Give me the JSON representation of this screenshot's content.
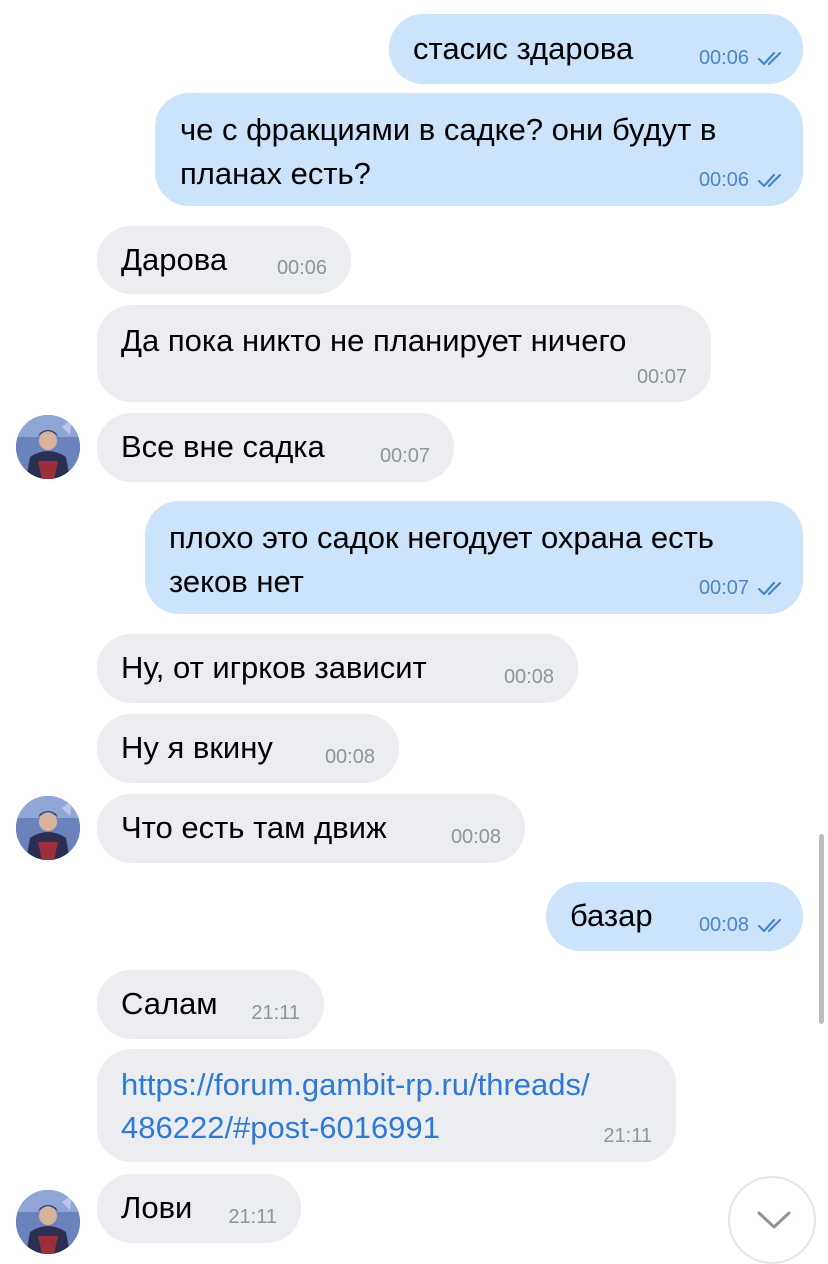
{
  "chat": {
    "messages": [
      {
        "direction": "outgoing",
        "text": "стасис здарова",
        "time": "00:06",
        "read": true
      },
      {
        "direction": "outgoing",
        "lines": [
          "че с фракциями в садке? они будут в",
          "планах есть?"
        ],
        "time": "00:06",
        "read": true
      },
      {
        "direction": "incoming",
        "text": "Дарова",
        "time": "00:06"
      },
      {
        "direction": "incoming",
        "text": "Да пока никто не планирует ничего",
        "time": "00:07"
      },
      {
        "direction": "incoming",
        "text": "Все вне садка",
        "time": "00:07"
      },
      {
        "direction": "outgoing",
        "lines": [
          "плохо это садок негодует охрана есть",
          "зеков нет"
        ],
        "time": "00:07",
        "read": true
      },
      {
        "direction": "incoming",
        "text": "Ну, от игрков зависит",
        "time": "00:08"
      },
      {
        "direction": "incoming",
        "text": "Ну я вкину",
        "time": "00:08"
      },
      {
        "direction": "incoming",
        "text": "Что есть там движ",
        "time": "00:08"
      },
      {
        "direction": "outgoing",
        "text": "базар",
        "time": "00:08",
        "read": true
      },
      {
        "direction": "incoming",
        "text": "Салам",
        "time": "21:11"
      },
      {
        "direction": "incoming",
        "lines": [
          "https://forum.gambit-rp.ru/threads/",
          "486222/#post-6016991"
        ],
        "time": "21:11",
        "is_link": true
      },
      {
        "direction": "incoming",
        "text": "Лови",
        "time": "21:11"
      }
    ]
  },
  "icons": {
    "read_status": "double-check-icon",
    "scroll_down": "chevron-down-icon",
    "avatar": "contact-avatar"
  },
  "colors": {
    "outgoing_bubble": "#cce4fb",
    "incoming_bubble": "#ebedf0",
    "link": "#2c7ad6",
    "outgoing_time": "#4a86c6",
    "incoming_time": "#8f959b"
  }
}
